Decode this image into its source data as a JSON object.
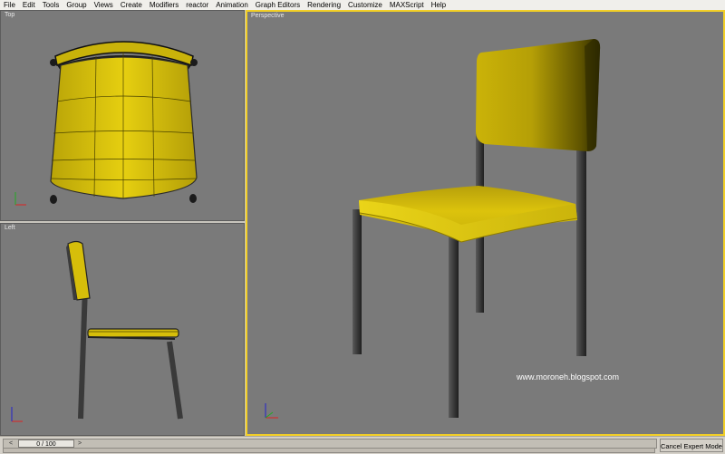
{
  "menu": [
    "File",
    "Edit",
    "Tools",
    "Group",
    "Views",
    "Create",
    "Modifiers",
    "reactor",
    "Animation",
    "Graph Editors",
    "Rendering",
    "Customize",
    "MAXScript",
    "Help"
  ],
  "viewports": {
    "top": {
      "label": "Top"
    },
    "left": {
      "label": "Left"
    },
    "perspective": {
      "label": "Perspective"
    }
  },
  "watermark": "www.moroneh.blogspot.com",
  "timeline": {
    "frame": "0 / 100",
    "prev_arrow": "<",
    "next_arrow": ">"
  },
  "status": {
    "cancel_expert": "Cancel Expert Mode"
  },
  "colors": {
    "chair_yellow": "#d3bc0a",
    "chair_legs": "#3c3c3c",
    "viewport_bg": "#7a7a7a",
    "active_border": "#f2cf27"
  },
  "icons": {
    "axis_gizmo": "xyz-axis-icon"
  }
}
